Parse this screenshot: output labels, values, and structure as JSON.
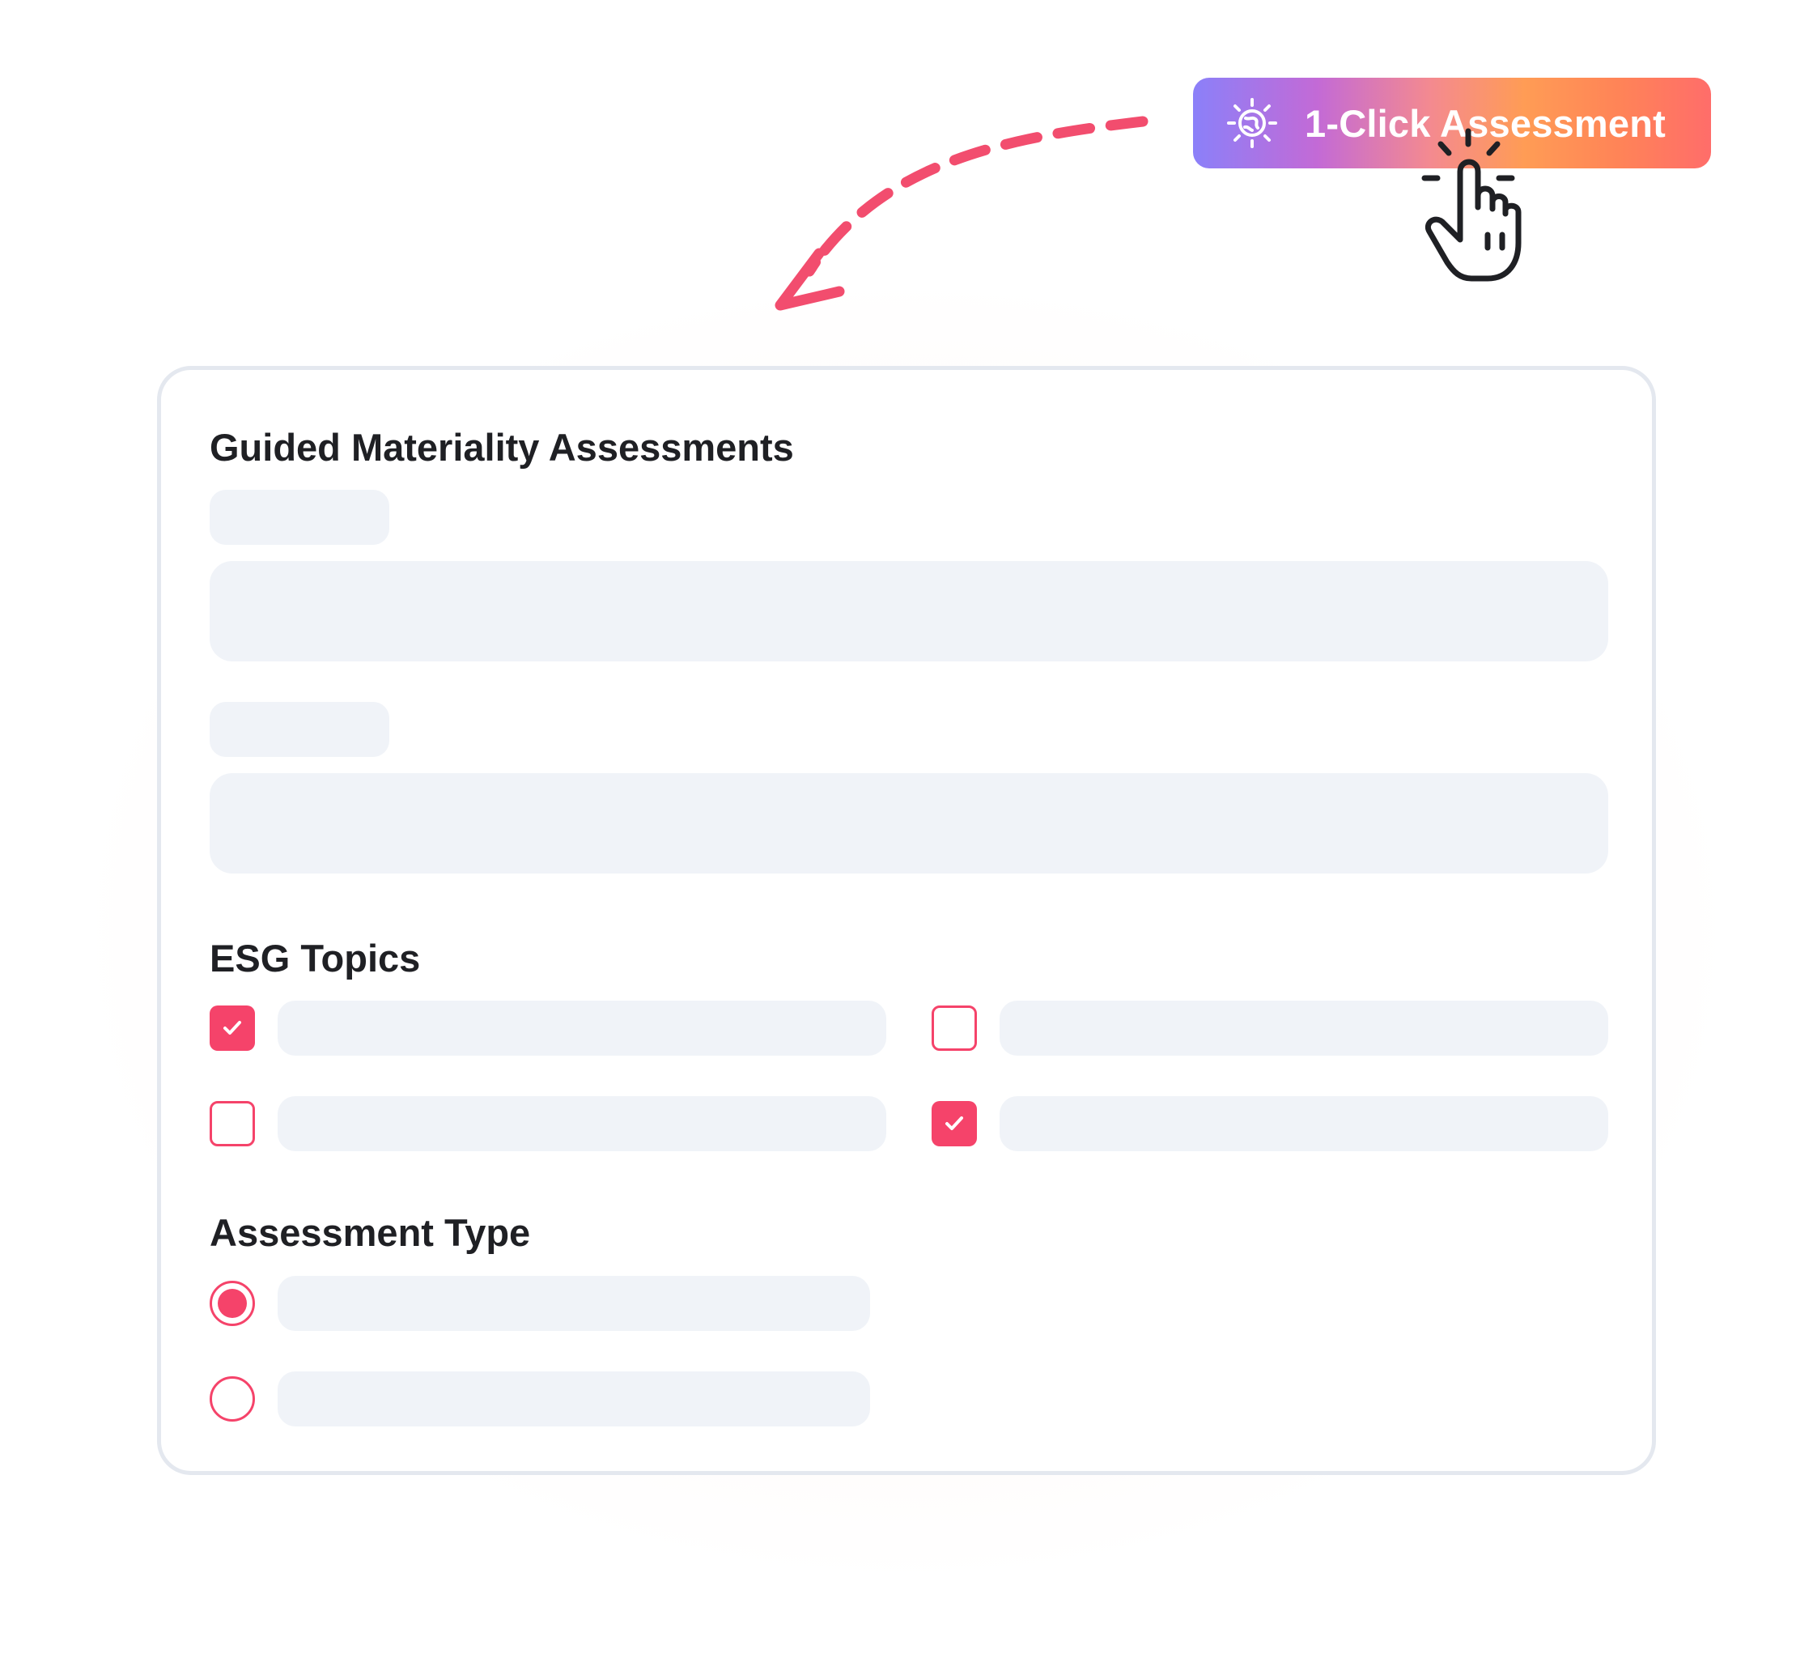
{
  "cta": {
    "label": "1-Click Assessment",
    "icon": "sparkle-globe-icon",
    "gradient_colors": [
      "#8b80f9",
      "#c36ad6",
      "#ff9c55",
      "#ff6d6a"
    ]
  },
  "pointer": {
    "icon": "hand-pointer-icon"
  },
  "arrow": {
    "color": "#f24d6e",
    "style": "dashed"
  },
  "form": {
    "title": "Guided Materiality Assessments",
    "esg_topics": {
      "title": "ESG Topics",
      "options": [
        {
          "checked": true
        },
        {
          "checked": false
        },
        {
          "checked": false
        },
        {
          "checked": true
        }
      ]
    },
    "assessment_type": {
      "title": "Assessment Type",
      "options": [
        {
          "selected": true
        },
        {
          "selected": false
        }
      ]
    }
  },
  "colors": {
    "accent": "#f5436a",
    "placeholder": "#f0f3f8",
    "card_border": "#e4e8ef",
    "text": "#1f2024"
  }
}
